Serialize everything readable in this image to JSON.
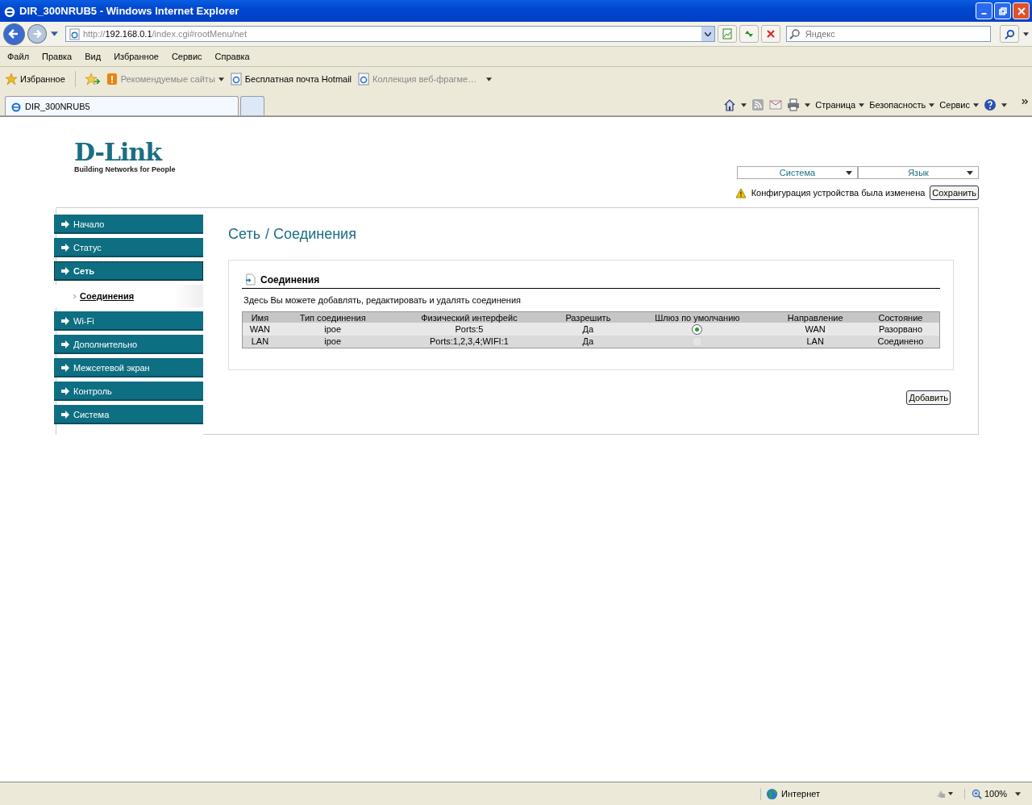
{
  "window": {
    "title": "DIR_300NRUB5 - Windows Internet Explorer"
  },
  "address": {
    "scheme": "http://",
    "host": "192.168.0.1",
    "path": "/index.cgi#rootMenu/net"
  },
  "search": {
    "placeholder": "Яндекс"
  },
  "menu": [
    "Файл",
    "Правка",
    "Вид",
    "Избранное",
    "Сервис",
    "Справка"
  ],
  "favorites": {
    "button": "Избранное",
    "links": [
      {
        "label": "Рекомендуемые сайты",
        "disabled": true,
        "kind": "feed"
      },
      {
        "label": "Бесплатная почта Hotmail",
        "disabled": false,
        "kind": "page"
      },
      {
        "label": "Коллекция веб-фрагме…",
        "disabled": true,
        "kind": "page"
      }
    ]
  },
  "tabs": [
    {
      "label": "DIR_300NRUB5",
      "selected": true
    }
  ],
  "command_bar": [
    "Страница",
    "Безопасность",
    "Сервис"
  ],
  "page": {
    "logo": {
      "name": "D-Link",
      "tagline": "Building Networks for People"
    },
    "top_menus": [
      "Система",
      "Язык"
    ],
    "notice": "Конфигурация устройства была изменена",
    "save_button": "Сохранить",
    "sidebar": [
      {
        "label": "Начало",
        "selected": false
      },
      {
        "label": "Статус",
        "selected": false
      },
      {
        "label": "Сеть",
        "selected": true,
        "children": [
          {
            "label": "Соединения",
            "selected": true
          }
        ]
      },
      {
        "label": "Wi-Fi",
        "selected": false
      },
      {
        "label": "Дополнительно",
        "selected": false
      },
      {
        "label": "Межсетевой экран",
        "selected": false
      },
      {
        "label": "Контроль",
        "selected": false
      },
      {
        "label": "Система",
        "selected": false
      }
    ],
    "breadcrumb": [
      "Сеть",
      "/ Соединения"
    ],
    "section": {
      "title": "Соединения",
      "description": "Здесь Вы можете добавлять, редактировать и удалять соединения",
      "columns": [
        "Имя",
        "Тип соединения",
        "Физический интерфейс",
        "Разрешить",
        "Шлюз по умолчанию",
        "Направление",
        "Состояние"
      ],
      "rows": [
        {
          "name": "WAN",
          "type": "ipoe",
          "interface": "Ports:5",
          "enabled": "Да",
          "gateway": {
            "selected": true,
            "disabled": false
          },
          "direction": "WAN",
          "state": "Разорвано"
        },
        {
          "name": "LAN",
          "type": "ipoe",
          "interface": "Ports:1,2,3,4;WIFI:1",
          "enabled": "Да",
          "gateway": {
            "selected": false,
            "disabled": true
          },
          "direction": "LAN",
          "state": "Соединено"
        }
      ]
    },
    "add_button": "Добавить"
  },
  "status_bar": {
    "zone": "Интернет",
    "zoom": "100%"
  }
}
